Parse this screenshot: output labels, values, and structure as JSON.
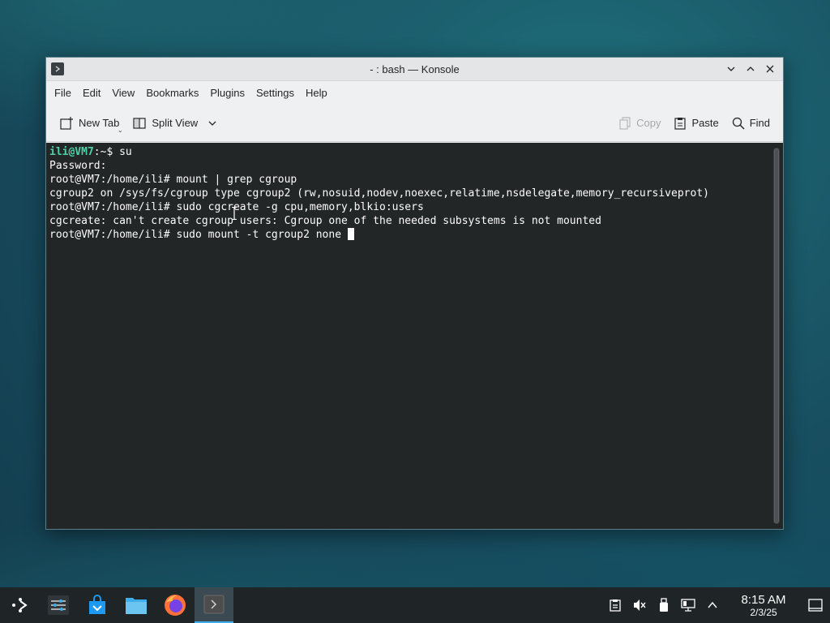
{
  "window": {
    "title": "- : bash — Konsole"
  },
  "menu": [
    "File",
    "Edit",
    "View",
    "Bookmarks",
    "Plugins",
    "Settings",
    "Help"
  ],
  "toolbar": {
    "new_tab": "New Tab",
    "split_view": "Split View",
    "copy": "Copy",
    "paste": "Paste",
    "find": "Find"
  },
  "terminal": {
    "line1_user": "ili@VM7",
    "line1_rest": ":~$ su",
    "line2": "Password:",
    "line3": "root@VM7:/home/ili# mount | grep cgroup",
    "line4": "cgroup2 on /sys/fs/cgroup type cgroup2 (rw,nosuid,nodev,noexec,relatime,nsdelegate,memory_recursiveprot)",
    "line5": "root@VM7:/home/ili# sudo cgcreate -g cpu,memory,blkio:users",
    "line6": "cgcreate: can't create cgroup users: Cgroup one of the needed subsystems is not mounted",
    "line7": "root@VM7:/home/ili# sudo mount -t cgroup2 none "
  },
  "taskbar": {
    "time": "8:15 AM",
    "date": "2/3/25"
  },
  "colors": {
    "terminal_bg": "#232627",
    "prompt_user": "#4fd1a5",
    "accent": "#3daee9"
  }
}
